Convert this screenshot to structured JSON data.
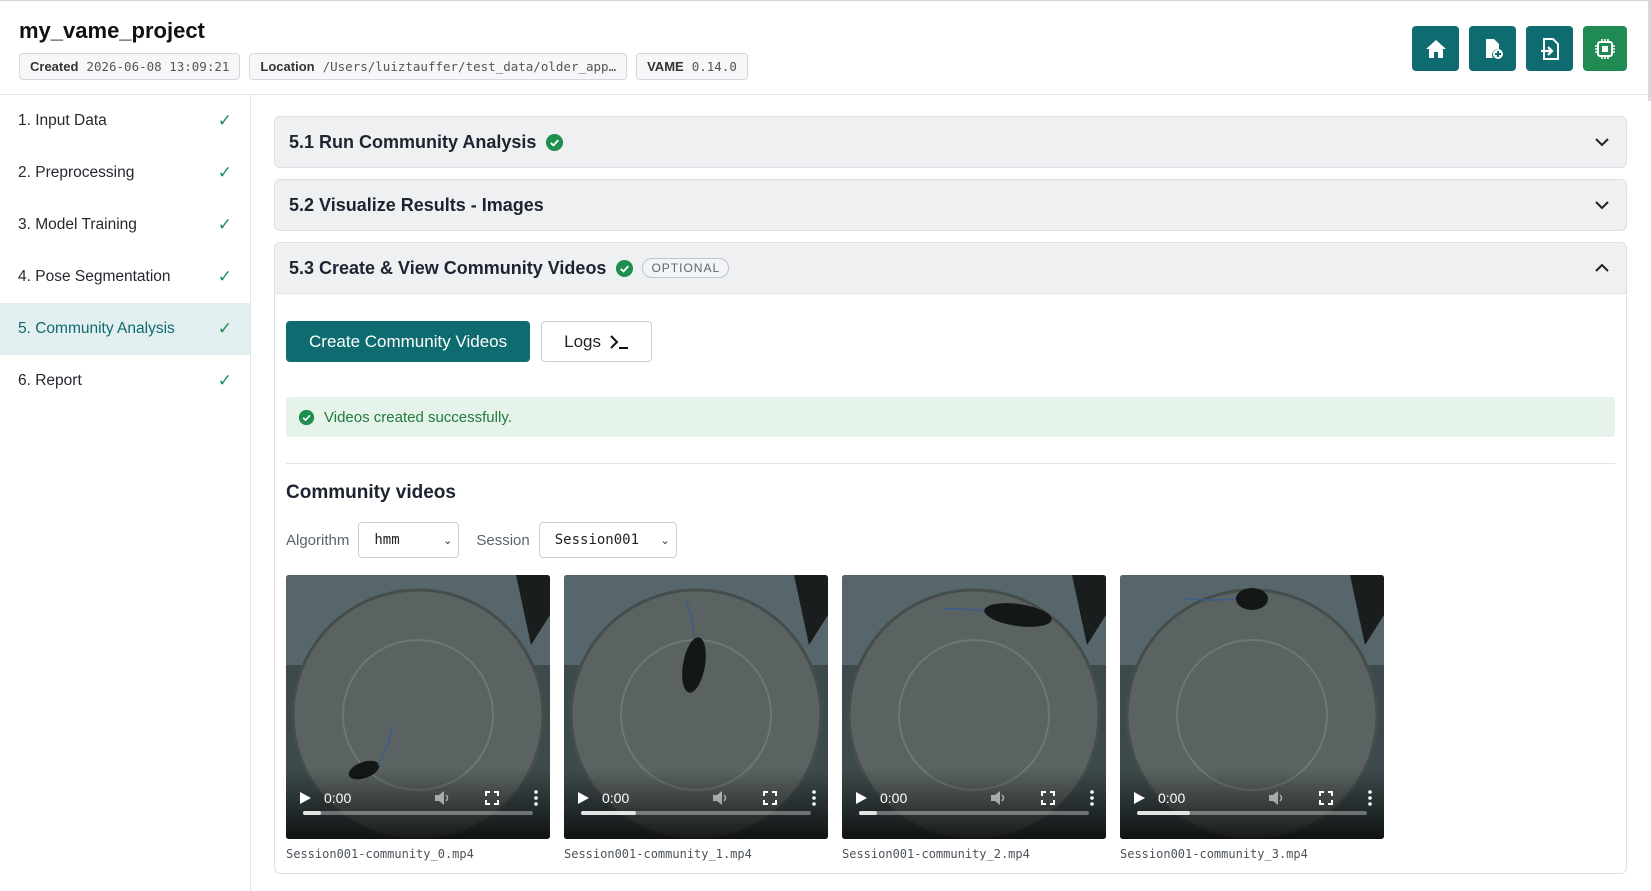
{
  "project": {
    "title": "my_vame_project",
    "created_label": "Created",
    "created_value": "2026-06-08 13:09:21",
    "location_label": "Location",
    "location_value": "/Users/luiztauffer/test_data/older_app…",
    "version_label": "VAME",
    "version_value": "0.14.0"
  },
  "toolbar": {
    "buttons": [
      {
        "name": "home-button",
        "icon": "home-icon"
      },
      {
        "name": "new-project-button",
        "icon": "file-plus-icon"
      },
      {
        "name": "load-project-button",
        "icon": "sign-in-icon"
      },
      {
        "name": "resources-button",
        "icon": "cpu-chip-icon",
        "color": "#1f8a52"
      }
    ],
    "accent": "#0e6b6f"
  },
  "sidebar": {
    "items": [
      {
        "label": "1. Input Data",
        "done": "✓"
      },
      {
        "label": "2. Preprocessing",
        "done": "✓"
      },
      {
        "label": "3. Model Training",
        "done": "✓"
      },
      {
        "label": "4. Pose Segmentation",
        "done": "✓"
      },
      {
        "label": "5. Community Analysis",
        "done": "✓",
        "active": true
      },
      {
        "label": "6. Report",
        "done": "✓"
      }
    ]
  },
  "sections": [
    {
      "title": "5.1 Run Community Analysis",
      "status": "complete",
      "expanded": false
    },
    {
      "title": "5.2 Visualize Results - Images",
      "expanded": false
    },
    {
      "title": "5.3 Create & View Community Videos",
      "status": "complete",
      "badge": "OPTIONAL",
      "expanded": true
    }
  ],
  "videos_panel": {
    "create_button": "Create Community Videos",
    "logs_button": "Logs",
    "success_message": "Videos created successfully.",
    "heading": "Community videos",
    "algorithm_label": "Algorithm",
    "algorithm_value": "hmm",
    "session_label": "Session",
    "session_value": "Session001",
    "videos": [
      {
        "file": "Session001-community_0.mp4",
        "time": "0:00",
        "progress": 0.08
      },
      {
        "file": "Session001-community_1.mp4",
        "time": "0:00",
        "progress": 0.24
      },
      {
        "file": "Session001-community_2.mp4",
        "time": "0:00",
        "progress": 0.08
      },
      {
        "file": "Session001-community_3.mp4",
        "time": "0:00",
        "progress": 0.23
      }
    ]
  }
}
